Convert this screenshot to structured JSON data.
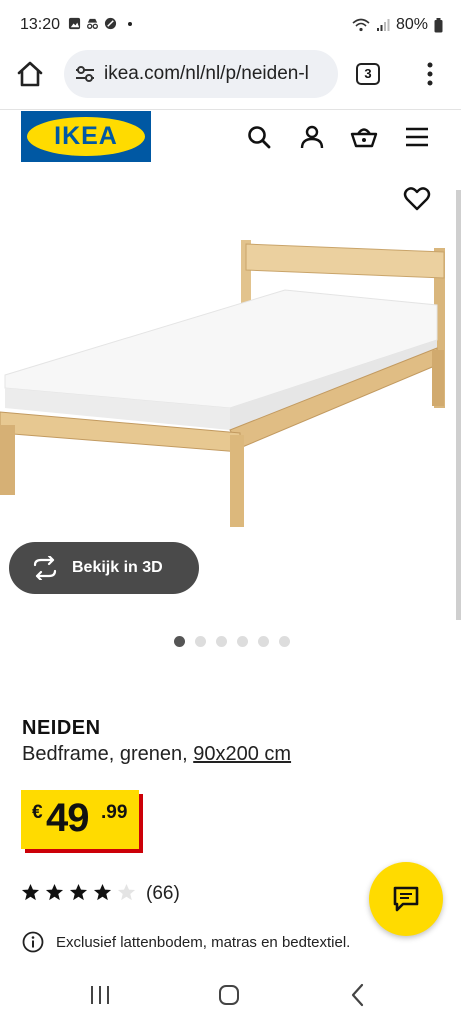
{
  "status_bar": {
    "time": "13:20",
    "battery": "80%"
  },
  "browser": {
    "url": "ikea.com/nl/nl/p/neiden-l",
    "tab_count": "3"
  },
  "brand": {
    "logo_text": "IKEA",
    "blue": "#0058a3",
    "yellow": "#ffdb00"
  },
  "header_icons": [
    "search-icon",
    "account-icon",
    "basket-icon",
    "hamburger-menu-icon"
  ],
  "gallery": {
    "view_3d_label": "Bekijk in 3D",
    "image_count": 6,
    "active_image": 1
  },
  "product": {
    "name": "NEIDEN",
    "description": "Bedframe, grenen, ",
    "size": "90x200 cm",
    "price": {
      "currency": "€",
      "integer": "49",
      "decimal": ".99"
    },
    "rating": {
      "stars": 4,
      "max": 5,
      "count": "(66)"
    },
    "info_note": "Exclusief lattenbodem, matras en bedtextiel."
  },
  "colors": {
    "price_shadow": "#cc0008",
    "dark_button": "#4a4a4a"
  }
}
